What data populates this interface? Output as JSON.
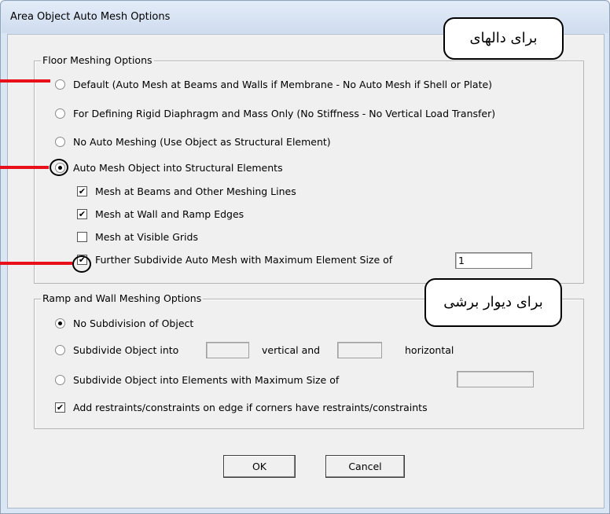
{
  "window": {
    "title": "Area Object Auto Mesh Options"
  },
  "floor": {
    "legend": "Floor Meshing Options",
    "opt_default": "Default  (Auto Mesh at Beams and Walls if Membrane - No Auto Mesh if Shell or Plate)",
    "opt_rigid": "For Defining Rigid Diaphragm and Mass Only  (No Stiffness - No Vertical Load Transfer)",
    "opt_none": "No Auto Meshing  (Use Object as Structural Element)",
    "opt_auto": "Auto Mesh Object into Structural Elements",
    "chk_beams": "Mesh at Beams and Other Meshing Lines",
    "chk_walls": "Mesh at Wall and Ramp Edges",
    "chk_grids": "Mesh at Visible Grids",
    "chk_subdivide": "Further Subdivide Auto Mesh with Maximum Element Size of",
    "max_size_value": "1",
    "selected": "opt_auto",
    "checked": {
      "chk_beams": true,
      "chk_walls": true,
      "chk_grids": false,
      "chk_subdivide": true
    }
  },
  "ramp": {
    "legend": "Ramp and Wall Meshing Options",
    "opt_nosub": "No Subdivision of Object",
    "opt_sub_into": "Subdivide Object into",
    "vertical_and": "vertical  and",
    "horizontal": "horizontal",
    "opt_sub_max": "Subdivide Object into Elements with Maximum Size of",
    "chk_restraints": "Add restraints/constraints on edge if corners have restraints/constraints",
    "selected": "opt_nosub",
    "restraints_checked": true
  },
  "buttons": {
    "ok": "OK",
    "cancel": "Cancel"
  },
  "annotations": {
    "slabs": "برای دالهای",
    "shear_wall": "برای دیوار برشی",
    "color": "#e8101a"
  }
}
